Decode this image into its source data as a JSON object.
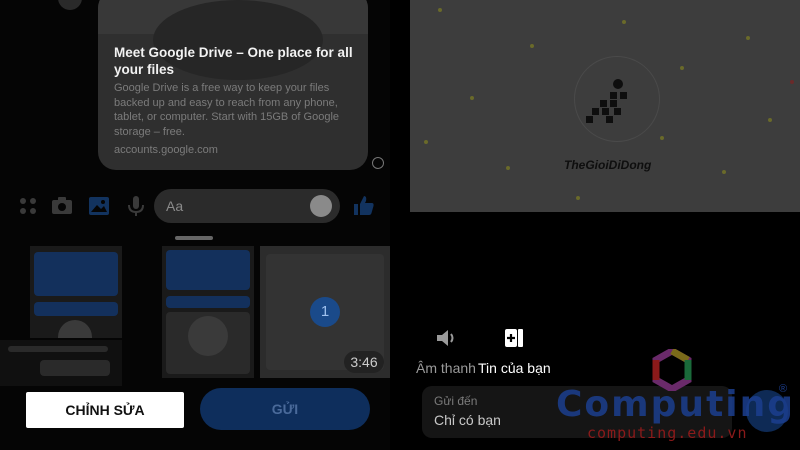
{
  "left_panel": {
    "link_card": {
      "title": "Meet Google Drive – One place for all your files",
      "description": "Google Drive is a free way to keep your files backed up and easy to reach from any phone, tablet, or computer. Start with 15GB of Google storage – free.",
      "url": "accounts.google.com"
    },
    "composer": {
      "placeholder": "Aa",
      "icons": [
        "apps-grid-icon",
        "camera-icon",
        "gallery-icon",
        "microphone-icon",
        "emoji-icon",
        "thumbs-up-icon"
      ]
    },
    "gallery": {
      "selected_index": "1",
      "video_duration": "3:46"
    },
    "buttons": {
      "edit": "CHỈNH SỬA",
      "send": "GỬI"
    }
  },
  "right_panel": {
    "image_caption": "TheGioiDiDong",
    "options": [
      {
        "label": "Âm thanh",
        "icon": "speaker-icon"
      },
      {
        "label": "Tin của bạn",
        "icon": "add-story-icon"
      }
    ],
    "send_to": {
      "label": "Gửi đến",
      "value": "Chỉ có bạn"
    }
  },
  "watermark": {
    "brand": "Computing",
    "registered": "®",
    "url": "computing.edu.vn"
  },
  "colors": {
    "messenger_blue": "#0084ff",
    "photo_bg": "#3d3d3d",
    "watermark_blue": "#1c3f8f",
    "watermark_red": "#8b1a1a"
  }
}
